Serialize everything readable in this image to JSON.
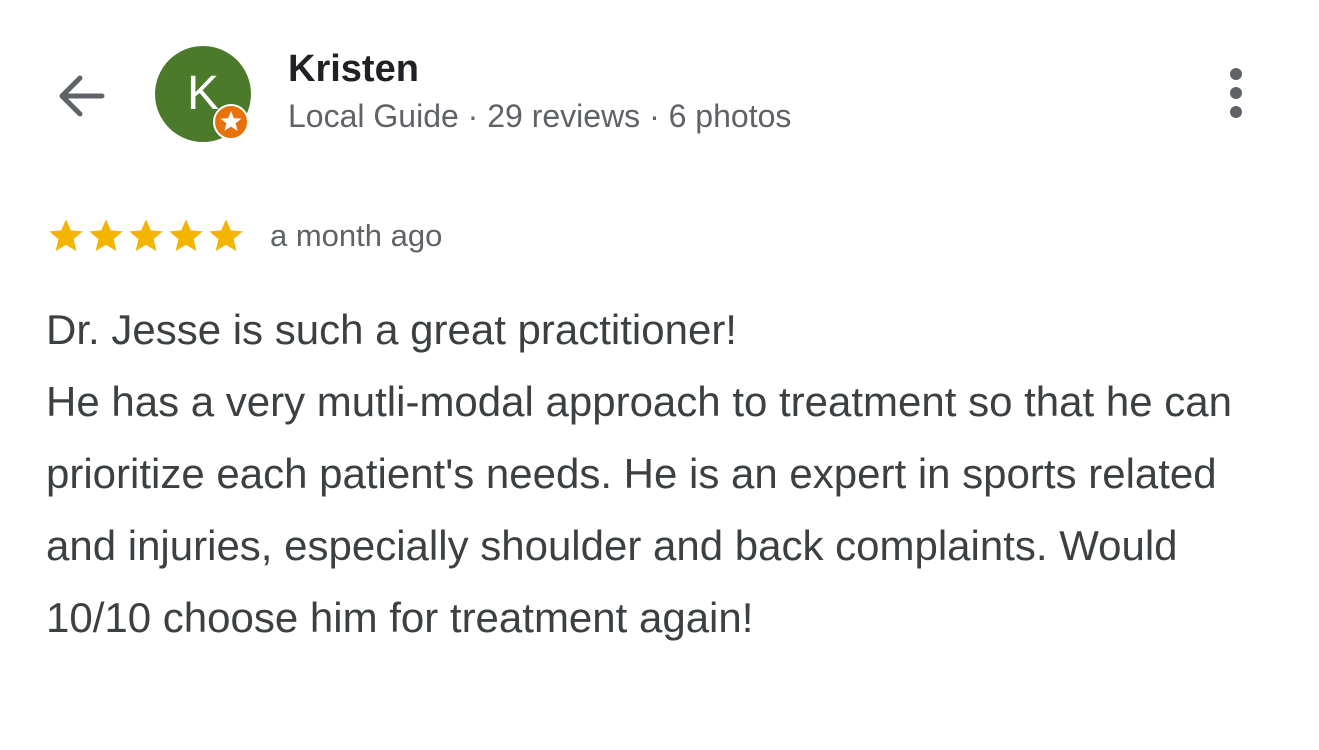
{
  "reviewer": {
    "avatar_letter": "K",
    "avatar_color": "#4a7a2a",
    "badge_color": "#e8710a",
    "name": "Kristen",
    "meta": "Local Guide · 29 reviews · 6 photos"
  },
  "review": {
    "rating": 5,
    "max_rating": 5,
    "star_color": "#f4b400",
    "time": "a month ago",
    "text": "Dr. Jesse is such a great practitioner!\nHe has a very mutli-modal approach to treatment so that he can prioritize each patient's needs. He is an expert in sports related and injuries, especially shoulder and back complaints. Would 10/10 choose him for treatment again!"
  },
  "icons": {
    "back": "arrow-back-icon",
    "more": "more-vert-icon",
    "star": "star-icon",
    "badge": "local-guide-star-icon"
  }
}
